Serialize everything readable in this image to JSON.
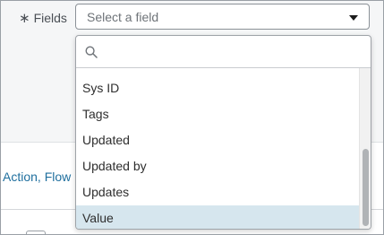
{
  "form": {
    "required_mark": "∗",
    "field_label": "Fields",
    "select_placeholder": "Select a field"
  },
  "dropdown": {
    "search_value": "",
    "options": [
      {
        "label": "Sys ID",
        "highlighted": false
      },
      {
        "label": "Tags",
        "highlighted": false
      },
      {
        "label": "Updated",
        "highlighted": false
      },
      {
        "label": "Updated by",
        "highlighted": false
      },
      {
        "label": "Updates",
        "highlighted": false
      },
      {
        "label": "Value",
        "highlighted": true
      }
    ]
  },
  "background": {
    "link_text": "Action, Flow Lo"
  },
  "colors": {
    "highlight": "#d6e6ee",
    "link": "#1f6f9e",
    "panel_bg": "#f5f6f7"
  },
  "icons": {
    "search": "search-icon",
    "caret": "chevron-down-icon"
  }
}
